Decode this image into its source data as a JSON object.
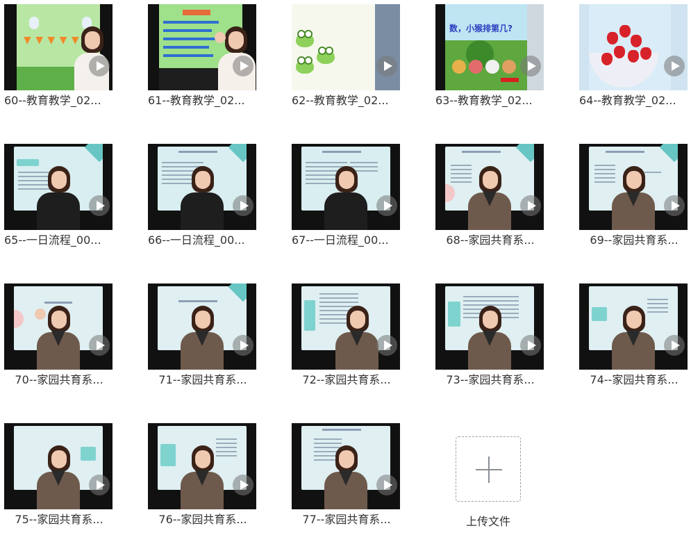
{
  "files": [
    {
      "label": "60--教育教学_02..."
    },
    {
      "label": "61--教育教学_02..."
    },
    {
      "label": "62--教育教学_02..."
    },
    {
      "label": "63--教育教学_02..."
    },
    {
      "label": "64--教育教学_02..."
    },
    {
      "label": "65--一日流程_00..."
    },
    {
      "label": "66--一日流程_00..."
    },
    {
      "label": "67--一日流程_00..."
    },
    {
      "label": "68--家园共育系..."
    },
    {
      "label": "69--家园共育系..."
    },
    {
      "label": "70--家园共育系..."
    },
    {
      "label": "71--家园共育系..."
    },
    {
      "label": "72--家园共育系..."
    },
    {
      "label": "73--家园共育系..."
    },
    {
      "label": "74--家园共育系..."
    },
    {
      "label": "75--家园共育系..."
    },
    {
      "label": "76--家园共育系..."
    },
    {
      "label": "77--家园共育系..."
    }
  ],
  "thumb_63_text": "数，小猴排第几?",
  "upload": {
    "label": "上传文件"
  },
  "colors": {
    "text": "#333333",
    "play_overlay": "#787878",
    "upload_border": "#9aa0a6"
  },
  "icons": {
    "play": "play-icon",
    "upload": "plus-icon"
  }
}
